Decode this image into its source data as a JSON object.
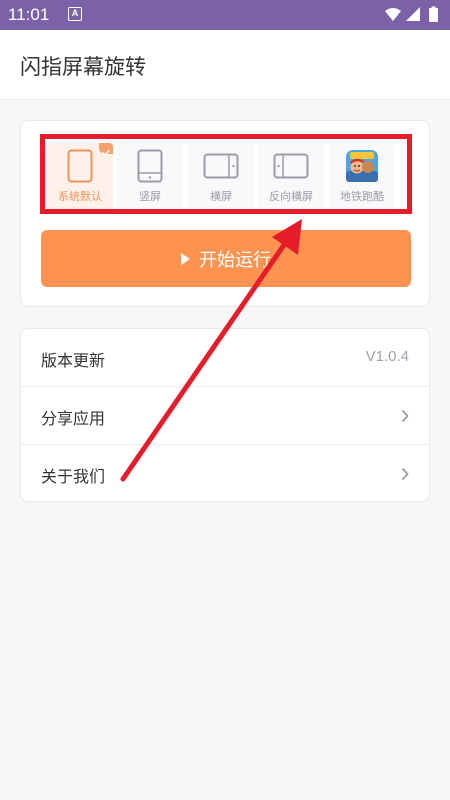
{
  "status_bar": {
    "time": "11:01",
    "notification_glyph": "A"
  },
  "app": {
    "title": "闪指屏幕旋转"
  },
  "modes": [
    {
      "label": "系统默认",
      "icon": "phone-outline-icon",
      "selected": true
    },
    {
      "label": "竖屏",
      "icon": "portrait-icon",
      "selected": false
    },
    {
      "label": "横屏",
      "icon": "landscape-icon",
      "selected": false
    },
    {
      "label": "反向横屏",
      "icon": "reverse-landscape-icon",
      "selected": false
    },
    {
      "label": "地铁跑酷",
      "icon": "subway-surfers-game-icon",
      "selected": false
    }
  ],
  "start_button": {
    "label": "开始运行"
  },
  "menu": {
    "version": {
      "label": "版本更新",
      "value": "V1.0.4"
    },
    "share": {
      "label": "分享应用"
    },
    "about": {
      "label": "关于我们"
    }
  },
  "colors": {
    "status_bar": "#7b61a8",
    "accent_orange": "#fd934e",
    "highlight_red": "#e51c2a",
    "selected_label": "#f2925a"
  }
}
